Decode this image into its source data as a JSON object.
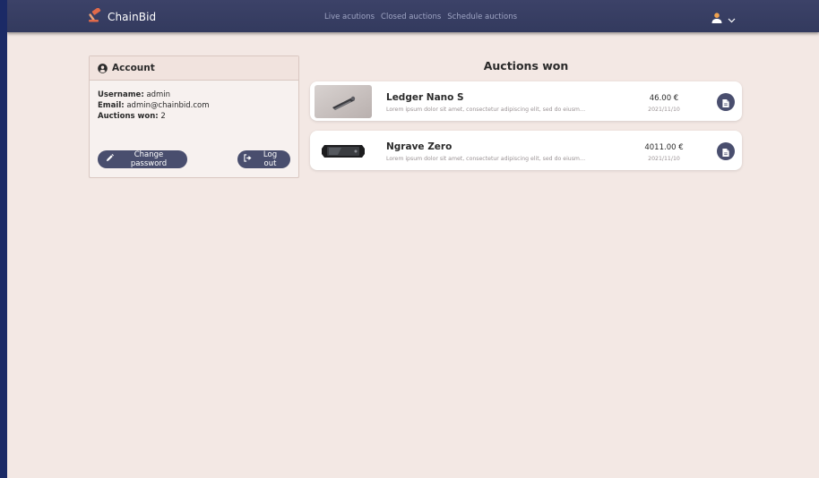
{
  "navbar": {
    "brand": "ChainBid",
    "links": [
      "Live acutions",
      "Closed auctions",
      "Schedule auctions"
    ]
  },
  "account": {
    "title": "Account",
    "username_label": "Username:",
    "username": "admin",
    "email_label": "Email:",
    "email": "admin@chainbid.com",
    "auctions_won_label": "Auctions won:",
    "auctions_won": "2",
    "change_password_label": "Change password",
    "logout_label": "Log out"
  },
  "auctions_won": {
    "title": "Auctions won",
    "items": [
      {
        "name": "Ledger Nano S",
        "description": "Lorem ipsum dolor sit amet, consectetur adipiscing elit, sed do eiusm…",
        "price": "46.00 €",
        "date": "2021/11/10"
      },
      {
        "name": "Ngrave Zero",
        "description": "Lorem ipsum dolor sit amet, consectetur adipiscing elit, sed do eiusm…",
        "price": "4011.00 €",
        "date": "2021/11/10"
      }
    ]
  },
  "colors": {
    "navbar": "#353b60",
    "background": "#f3e8e4",
    "button": "#494e6e",
    "outer": "#1b2a66"
  },
  "icons": {
    "brand": "gavel-icon",
    "user": "user-icon",
    "account": "user-circle-icon",
    "change_password": "pencil-icon",
    "logout": "sign-out-icon",
    "invoice": "file-icon"
  }
}
